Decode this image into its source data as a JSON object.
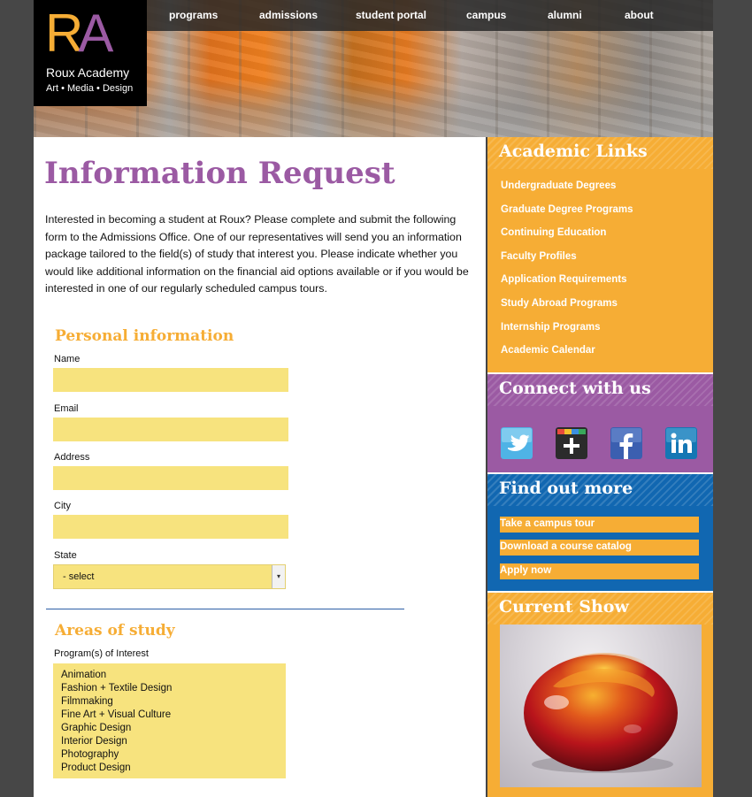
{
  "brand": {
    "letter_r": "R",
    "letter_a": "A",
    "name": "Roux Academy",
    "tagline": "Art • Media • Design"
  },
  "nav": {
    "items": [
      "programs",
      "admissions",
      "student portal",
      "campus",
      "alumni",
      "about"
    ]
  },
  "main": {
    "title": "Information Request",
    "intro": "Interested in becoming a student at Roux? Please complete and submit the following form to the Admissions Office. One of our representatives will send you an information package tailored to the field(s) of study that interest you. Please indicate whether you would like additional information on the financial aid options available or if you would be interested in one of our regularly scheduled campus tours.",
    "personal": {
      "heading": "Personal information",
      "fields": {
        "name": {
          "label": "Name",
          "value": ""
        },
        "email": {
          "label": "Email",
          "value": ""
        },
        "address": {
          "label": "Address",
          "value": ""
        },
        "city": {
          "label": "City",
          "value": ""
        },
        "state": {
          "label": "State",
          "value": "- select"
        }
      }
    },
    "study": {
      "heading": "Areas of study",
      "label": "Program(s) of Interest",
      "options": [
        "Animation",
        "Fashion + Textile Design",
        "Filmmaking",
        "Fine Art + Visual Culture",
        "Graphic Design",
        "Interior Design",
        "Photography",
        "Product Design"
      ]
    }
  },
  "sidebar": {
    "academic": {
      "title": "Academic Links",
      "links": [
        "Undergraduate Degrees",
        "Graduate Degree Programs",
        "Continuing Education",
        "Faculty Profiles",
        "Application Requirements",
        "Study Abroad Programs",
        "Internship Programs",
        "Academic Calendar"
      ]
    },
    "connect": {
      "title": "Connect with us",
      "icons": [
        "twitter-icon",
        "google-plus-icon",
        "facebook-icon",
        "linkedin-icon"
      ]
    },
    "findout": {
      "title": "Find out more",
      "buttons": [
        "Take a campus tour",
        "Download a course catalog",
        "Apply now"
      ]
    },
    "show": {
      "title": "Current Show"
    }
  },
  "colors": {
    "purple": "#9b5aa3",
    "orange": "#f6ad35",
    "blue": "#1167b1",
    "input_yellow": "#f7e37e",
    "page_bg": "#474747"
  }
}
